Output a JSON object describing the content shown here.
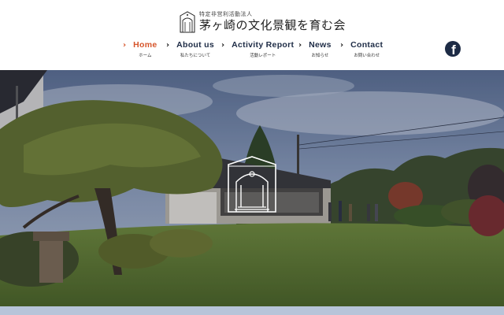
{
  "site": {
    "org_type": "特定非営利活動法人",
    "name": "茅ヶ崎の文化景観を育む会"
  },
  "nav": [
    {
      "en": "Home",
      "jp": "ホーム",
      "active": true
    },
    {
      "en": "About us",
      "jp": "私たちについて",
      "active": false
    },
    {
      "en": "Activity Report",
      "jp": "活動レポート",
      "active": false
    },
    {
      "en": "News",
      "jp": "お知らせ",
      "active": false
    },
    {
      "en": "Contact",
      "jp": "お問い合わせ",
      "active": false
    }
  ],
  "social": {
    "facebook_icon": "facebook-icon",
    "glyph": "f"
  },
  "icons": {
    "chevron": "›"
  },
  "colors": {
    "accent": "#d6552b",
    "navy": "#1d2b45",
    "band": "#b7c4d9"
  }
}
